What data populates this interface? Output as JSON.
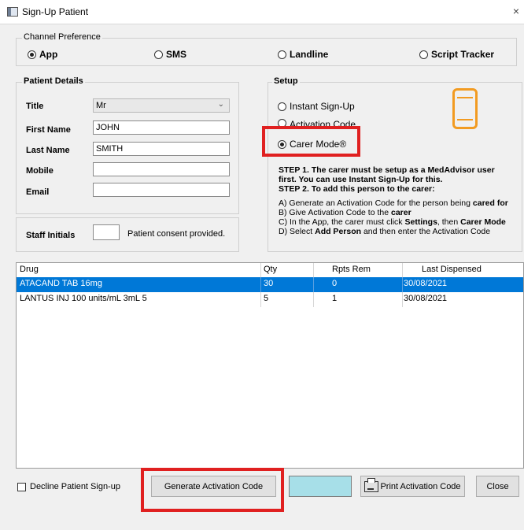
{
  "window": {
    "title": "Sign-Up Patient",
    "close_glyph": "×"
  },
  "channel": {
    "label": "Channel Preference",
    "options": [
      {
        "label": "App",
        "selected": true,
        "bold": true
      },
      {
        "label": "SMS",
        "selected": false,
        "bold": true
      },
      {
        "label": "Landline",
        "selected": false,
        "bold": true
      },
      {
        "label": "Script Tracker",
        "selected": false,
        "bold": true
      }
    ]
  },
  "patient": {
    "label": "Patient Details",
    "title_label": "Title",
    "title_value": "Mr",
    "first_name_label": "First Name",
    "first_name_value": "JOHN",
    "last_name_label": "Last Name",
    "last_name_value": "SMITH",
    "mobile_label": "Mobile",
    "mobile_value": "",
    "email_label": "Email",
    "email_value": ""
  },
  "staff": {
    "label": "Staff Initials",
    "initials_value": "",
    "consent_text": "Patient consent provided."
  },
  "setup": {
    "label": "Setup",
    "options": [
      {
        "label": "Instant Sign-Up",
        "selected": false
      },
      {
        "label": "Activation Code",
        "selected": false
      },
      {
        "label": "Carer Mode®",
        "selected": true
      }
    ],
    "step1_line1": "STEP 1. The carer must be setup as a MedAdvisor user",
    "step1_line2": "first. You can use Instant Sign-Up for this.",
    "step2": "STEP 2. To add this person to the carer:",
    "noteA_pre": "A) Generate an Activation Code for the person being ",
    "noteA_bold": "cared for",
    "noteB_pre": "B) Give Activation Code to the ",
    "noteB_bold": "carer",
    "noteC_pre": "C) In the App, the carer must click ",
    "noteC_bold1": "Settings",
    "noteC_mid": ", then ",
    "noteC_bold2": "Carer Mode",
    "noteD_pre": "D) Select ",
    "noteD_bold": "Add Person",
    "noteD_post": " and then enter the Activation Code"
  },
  "table": {
    "columns": [
      "Drug",
      "Qty",
      "Rpts Rem",
      "Last Dispensed"
    ],
    "rows": [
      {
        "drug": "ATACAND TAB 16mg",
        "qty": "30",
        "rpts": "0",
        "last": "30/08/2021",
        "selected": true
      },
      {
        "drug": "LANTUS INJ 100 units/mL 3mL 5",
        "qty": "5",
        "rpts": "1",
        "last": "30/08/2021",
        "selected": false
      }
    ]
  },
  "footer": {
    "decline_label": "Decline Patient Sign-up",
    "generate_label": "Generate Activation Code",
    "print_label": "Print Activation Code",
    "close_label": "Close"
  },
  "colors": {
    "selection": "#0078d7",
    "highlight": "#e02020",
    "phone": "#f29b21",
    "code_box": "#a7dfe8"
  }
}
